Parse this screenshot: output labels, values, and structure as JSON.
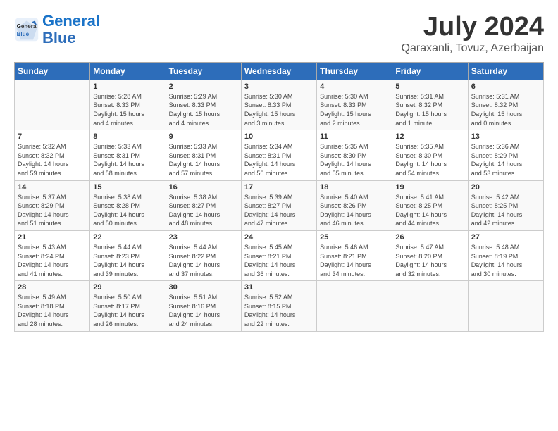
{
  "header": {
    "logo_general": "General",
    "logo_blue": "Blue",
    "title": "July 2024",
    "location": "Qaraxanli, Tovuz, Azerbaijan"
  },
  "days_of_week": [
    "Sunday",
    "Monday",
    "Tuesday",
    "Wednesday",
    "Thursday",
    "Friday",
    "Saturday"
  ],
  "weeks": [
    [
      {
        "day": "",
        "info": ""
      },
      {
        "day": "1",
        "info": "Sunrise: 5:28 AM\nSunset: 8:33 PM\nDaylight: 15 hours\nand 4 minutes."
      },
      {
        "day": "2",
        "info": "Sunrise: 5:29 AM\nSunset: 8:33 PM\nDaylight: 15 hours\nand 4 minutes."
      },
      {
        "day": "3",
        "info": "Sunrise: 5:30 AM\nSunset: 8:33 PM\nDaylight: 15 hours\nand 3 minutes."
      },
      {
        "day": "4",
        "info": "Sunrise: 5:30 AM\nSunset: 8:33 PM\nDaylight: 15 hours\nand 2 minutes."
      },
      {
        "day": "5",
        "info": "Sunrise: 5:31 AM\nSunset: 8:32 PM\nDaylight: 15 hours\nand 1 minute."
      },
      {
        "day": "6",
        "info": "Sunrise: 5:31 AM\nSunset: 8:32 PM\nDaylight: 15 hours\nand 0 minutes."
      }
    ],
    [
      {
        "day": "7",
        "info": "Sunrise: 5:32 AM\nSunset: 8:32 PM\nDaylight: 14 hours\nand 59 minutes."
      },
      {
        "day": "8",
        "info": "Sunrise: 5:33 AM\nSunset: 8:31 PM\nDaylight: 14 hours\nand 58 minutes."
      },
      {
        "day": "9",
        "info": "Sunrise: 5:33 AM\nSunset: 8:31 PM\nDaylight: 14 hours\nand 57 minutes."
      },
      {
        "day": "10",
        "info": "Sunrise: 5:34 AM\nSunset: 8:31 PM\nDaylight: 14 hours\nand 56 minutes."
      },
      {
        "day": "11",
        "info": "Sunrise: 5:35 AM\nSunset: 8:30 PM\nDaylight: 14 hours\nand 55 minutes."
      },
      {
        "day": "12",
        "info": "Sunrise: 5:35 AM\nSunset: 8:30 PM\nDaylight: 14 hours\nand 54 minutes."
      },
      {
        "day": "13",
        "info": "Sunrise: 5:36 AM\nSunset: 8:29 PM\nDaylight: 14 hours\nand 53 minutes."
      }
    ],
    [
      {
        "day": "14",
        "info": "Sunrise: 5:37 AM\nSunset: 8:29 PM\nDaylight: 14 hours\nand 51 minutes."
      },
      {
        "day": "15",
        "info": "Sunrise: 5:38 AM\nSunset: 8:28 PM\nDaylight: 14 hours\nand 50 minutes."
      },
      {
        "day": "16",
        "info": "Sunrise: 5:38 AM\nSunset: 8:27 PM\nDaylight: 14 hours\nand 48 minutes."
      },
      {
        "day": "17",
        "info": "Sunrise: 5:39 AM\nSunset: 8:27 PM\nDaylight: 14 hours\nand 47 minutes."
      },
      {
        "day": "18",
        "info": "Sunrise: 5:40 AM\nSunset: 8:26 PM\nDaylight: 14 hours\nand 46 minutes."
      },
      {
        "day": "19",
        "info": "Sunrise: 5:41 AM\nSunset: 8:25 PM\nDaylight: 14 hours\nand 44 minutes."
      },
      {
        "day": "20",
        "info": "Sunrise: 5:42 AM\nSunset: 8:25 PM\nDaylight: 14 hours\nand 42 minutes."
      }
    ],
    [
      {
        "day": "21",
        "info": "Sunrise: 5:43 AM\nSunset: 8:24 PM\nDaylight: 14 hours\nand 41 minutes."
      },
      {
        "day": "22",
        "info": "Sunrise: 5:44 AM\nSunset: 8:23 PM\nDaylight: 14 hours\nand 39 minutes."
      },
      {
        "day": "23",
        "info": "Sunrise: 5:44 AM\nSunset: 8:22 PM\nDaylight: 14 hours\nand 37 minutes."
      },
      {
        "day": "24",
        "info": "Sunrise: 5:45 AM\nSunset: 8:21 PM\nDaylight: 14 hours\nand 36 minutes."
      },
      {
        "day": "25",
        "info": "Sunrise: 5:46 AM\nSunset: 8:21 PM\nDaylight: 14 hours\nand 34 minutes."
      },
      {
        "day": "26",
        "info": "Sunrise: 5:47 AM\nSunset: 8:20 PM\nDaylight: 14 hours\nand 32 minutes."
      },
      {
        "day": "27",
        "info": "Sunrise: 5:48 AM\nSunset: 8:19 PM\nDaylight: 14 hours\nand 30 minutes."
      }
    ],
    [
      {
        "day": "28",
        "info": "Sunrise: 5:49 AM\nSunset: 8:18 PM\nDaylight: 14 hours\nand 28 minutes."
      },
      {
        "day": "29",
        "info": "Sunrise: 5:50 AM\nSunset: 8:17 PM\nDaylight: 14 hours\nand 26 minutes."
      },
      {
        "day": "30",
        "info": "Sunrise: 5:51 AM\nSunset: 8:16 PM\nDaylight: 14 hours\nand 24 minutes."
      },
      {
        "day": "31",
        "info": "Sunrise: 5:52 AM\nSunset: 8:15 PM\nDaylight: 14 hours\nand 22 minutes."
      },
      {
        "day": "",
        "info": ""
      },
      {
        "day": "",
        "info": ""
      },
      {
        "day": "",
        "info": ""
      }
    ]
  ]
}
